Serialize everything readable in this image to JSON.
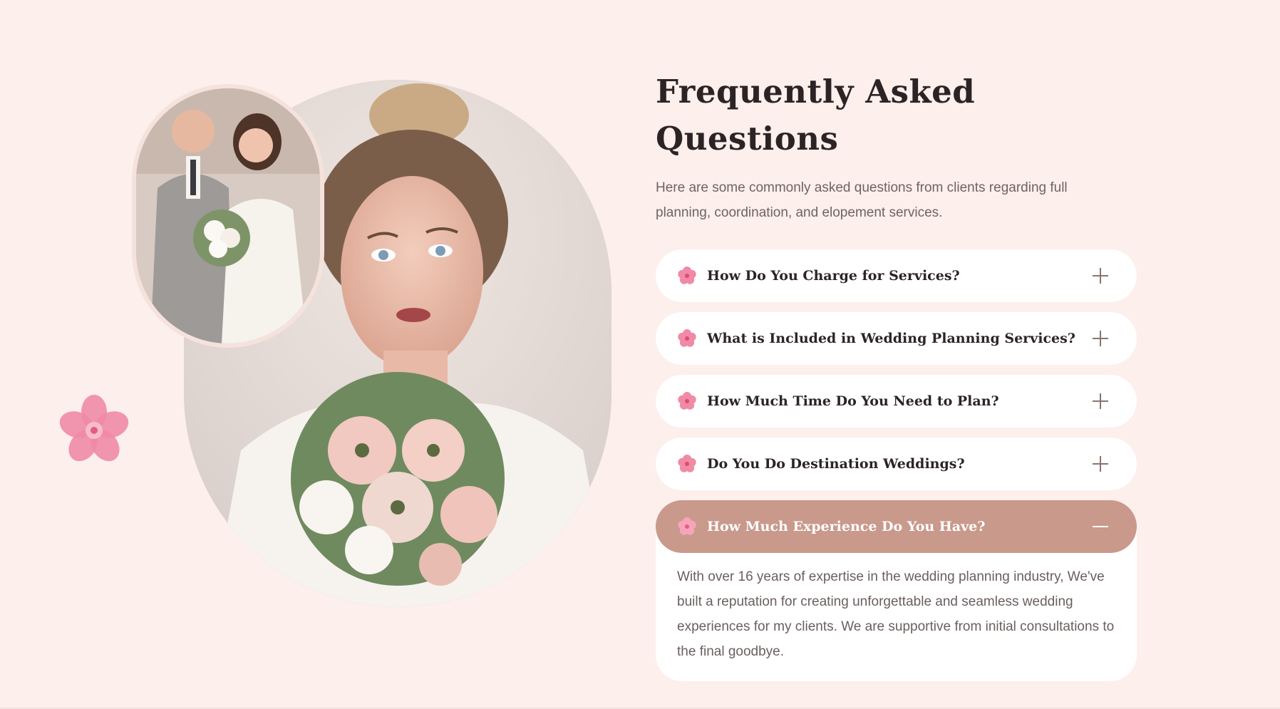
{
  "faq": {
    "title": "Frequently Asked Questions",
    "intro": "Here are some commonly asked questions from clients regarding full planning, coordination, and elopement services.",
    "items": [
      {
        "question": "How Do You Charge for Services?",
        "expanded": false
      },
      {
        "question": "What is Included in Wedding Planning Services?",
        "expanded": false
      },
      {
        "question": "How Much Time Do You Need to Plan?",
        "expanded": false
      },
      {
        "question": "Do You Do Destination Weddings?",
        "expanded": false
      },
      {
        "question": "How Much Experience Do You Have?",
        "expanded": true,
        "answer": "With over 16 years of expertise in the wedding planning industry, We've built a reputation for creating unforgettable and seamless wedding experiences for my clients. We are supportive from initial consultations to the final goodbye."
      }
    ],
    "item_icon": "pink-flower-icon",
    "collapsed_toggle_icon": "plus-icon",
    "expanded_toggle_icon": "minus-icon"
  },
  "images": {
    "main": "bride-with-bouquet-photo",
    "small": "groom-and-bride-photo",
    "decoration": "pink-flower-decoration"
  },
  "colors": {
    "background": "#fcefec",
    "accent": "#c9998b",
    "heading": "#2c2424",
    "body_text": "#6f6463",
    "flower_pink": "#f08aa6"
  }
}
